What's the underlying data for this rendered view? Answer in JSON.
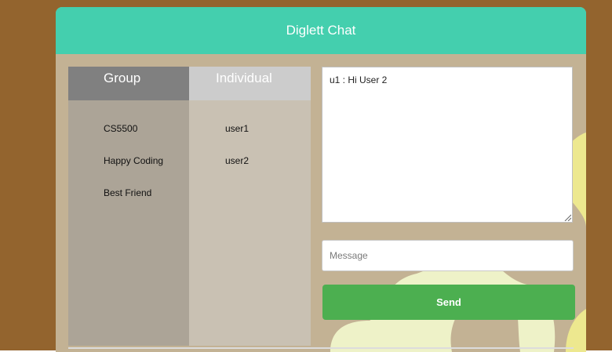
{
  "app": {
    "title": "Diglett Chat"
  },
  "tabs": {
    "group": {
      "label": "Group",
      "items": [
        "CS5500",
        "Happy Coding",
        "Best Friend"
      ]
    },
    "individual": {
      "label": "Individual",
      "items": [
        "user1",
        "user2"
      ]
    }
  },
  "chat": {
    "log": "u1 : Hi User 2",
    "message_placeholder": "Message",
    "message_value": "",
    "send_label": "Send"
  },
  "colors": {
    "background": "#93642e",
    "header": "#44cfae",
    "panel": "#c3b294",
    "send_button": "#4caf50"
  }
}
